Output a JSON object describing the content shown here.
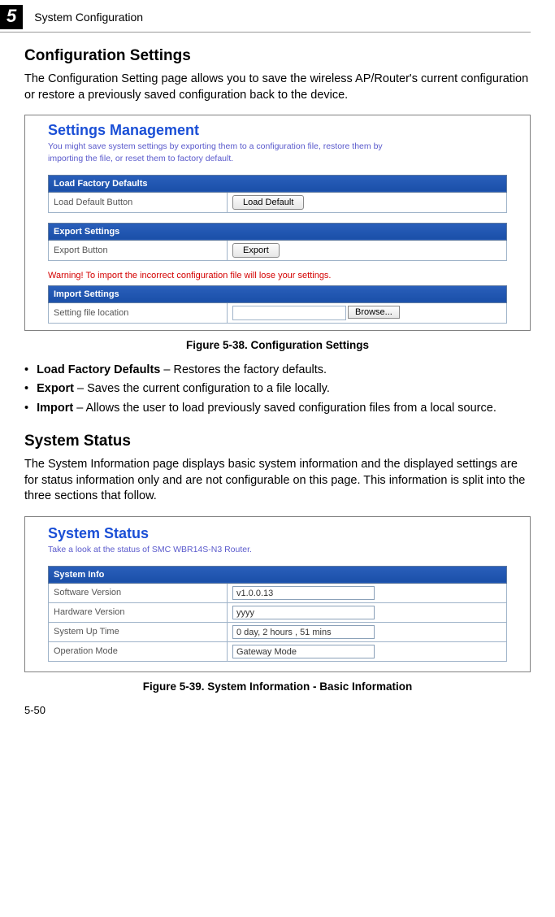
{
  "chapter": {
    "number": "5",
    "title": "System Configuration"
  },
  "section1": {
    "title": "Configuration Settings",
    "intro": "The Configuration Setting page allows you to save the wireless AP/Router's current configuration or restore a previously saved configuration back to the device."
  },
  "panel1": {
    "title": "Settings Management",
    "subtitle": "You might save system settings by exporting them to a configuration file, restore them by importing the file, or reset them to factory default.",
    "table1": {
      "header": "Load Factory Defaults",
      "row_label": "Load Default Button",
      "button": "Load Default"
    },
    "table2": {
      "header": "Export Settings",
      "row_label": "Export Button",
      "button": "Export"
    },
    "warning": "Warning! To import the incorrect configuration file will lose your settings.",
    "table3": {
      "header": "Import Settings",
      "row_label": "Setting file location",
      "button": "Browse..."
    }
  },
  "fig1_caption": "Figure 5-38.   Configuration Settings",
  "bullets": [
    {
      "term": "Load Factory Defaults",
      "desc": " – Restores the factory defaults."
    },
    {
      "term": "Export",
      "desc": " – Saves the current configuration to a file locally."
    },
    {
      "term": "Import",
      "desc": " – Allows the user to load previously saved configuration files from a local source."
    }
  ],
  "section2": {
    "title": "System Status",
    "intro": "The System Information page displays basic system information and the displayed settings are for status information only and are not configurable on this page. This information is split into the three sections that follow."
  },
  "panel2": {
    "title": "System Status",
    "subtitle": "Take a look at the status of SMC WBR14S-N3 Router.",
    "table": {
      "header": "System Info",
      "rows": [
        {
          "label": "Software Version",
          "value": "v1.0.0.13"
        },
        {
          "label": "Hardware Version",
          "value": "yyyy"
        },
        {
          "label": "System Up Time",
          "value": " 0 day,  2 hours ,  51 mins"
        },
        {
          "label": "Operation Mode",
          "value": "Gateway Mode"
        }
      ]
    }
  },
  "fig2_caption": "Figure 5-39.   System Information - Basic Information",
  "page_number": "5-50"
}
